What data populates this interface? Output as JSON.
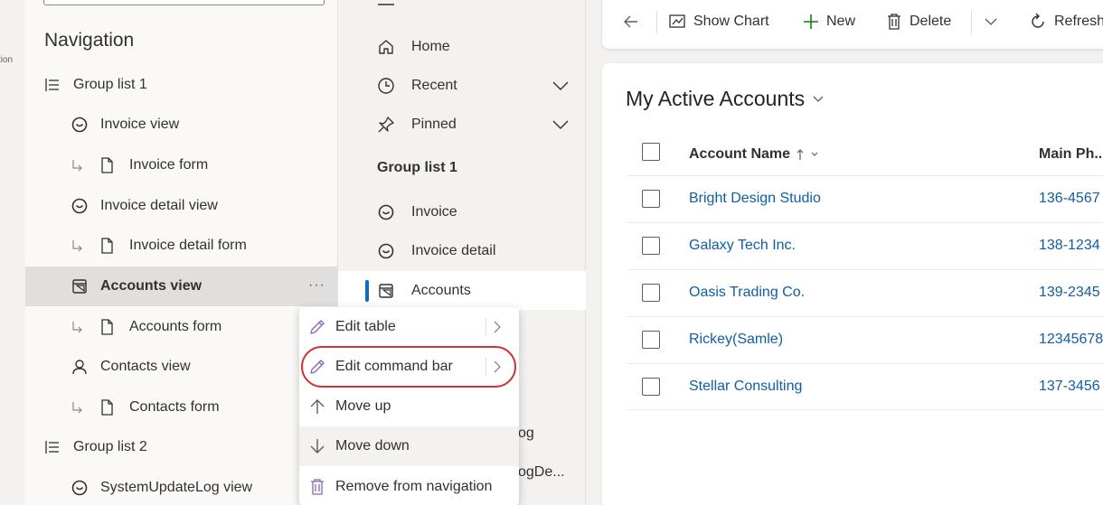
{
  "rail": {
    "label": "tion"
  },
  "navigation": {
    "title": "Navigation",
    "items": [
      {
        "label": "Group list 1",
        "icon": "list-icon",
        "level": "group"
      },
      {
        "label": "Invoice view",
        "icon": "view-icon",
        "level": "page"
      },
      {
        "label": "Invoice form",
        "icon": "document-icon",
        "level": "subpage"
      },
      {
        "label": "Invoice detail view",
        "icon": "view-icon",
        "level": "page"
      },
      {
        "label": "Invoice detail form",
        "icon": "document-icon",
        "level": "subpage"
      },
      {
        "label": "Accounts view",
        "icon": "table-icon",
        "level": "page",
        "selected": true,
        "more": "···"
      },
      {
        "label": "Accounts form",
        "icon": "document-icon",
        "level": "subpage"
      },
      {
        "label": "Contacts view",
        "icon": "person-icon",
        "level": "page"
      },
      {
        "label": "Contacts form",
        "icon": "document-icon",
        "level": "subpage"
      },
      {
        "label": "Group list 2",
        "icon": "list-icon",
        "level": "group"
      },
      {
        "label": "SystemUpdateLog view",
        "icon": "view-icon",
        "level": "page"
      }
    ]
  },
  "preview": {
    "items": [
      {
        "label": "Home",
        "icon": "home-icon"
      },
      {
        "label": "Recent",
        "icon": "clock-icon",
        "expandable": true
      },
      {
        "label": "Pinned",
        "icon": "pin-icon",
        "expandable": true
      }
    ],
    "group_label": "Group list 1",
    "group_items": [
      {
        "label": "Invoice",
        "icon": "view-icon"
      },
      {
        "label": "Invoice detail",
        "icon": "view-icon"
      },
      {
        "label": "Accounts",
        "icon": "table-icon",
        "active": true
      }
    ],
    "truncated": [
      "og",
      "ogDe..."
    ]
  },
  "commandbar": {
    "show_chart": "Show Chart",
    "new": "New",
    "delete": "Delete",
    "refresh": "Refresh"
  },
  "grid": {
    "view_title": "My Active Accounts",
    "columns": {
      "name": "Account Name",
      "phone": "Main Ph..."
    },
    "rows": [
      {
        "name": "Bright Design Studio",
        "phone": "136-4567"
      },
      {
        "name": "Galaxy Tech Inc.",
        "phone": "138-1234"
      },
      {
        "name": "Oasis Trading Co.",
        "phone": "139-2345"
      },
      {
        "name": "Rickey(Samle)",
        "phone": "12345678"
      },
      {
        "name": "Stellar Consulting",
        "phone": "137-3456"
      }
    ]
  },
  "context_menu": {
    "items": [
      {
        "label": "Edit table",
        "icon": "pencil-icon",
        "submenu": true
      },
      {
        "label": "Edit command bar",
        "icon": "pencil-icon",
        "submenu": true,
        "highlighted": true
      },
      {
        "label": "Move up",
        "icon": "arrow-up-icon"
      },
      {
        "label": "Move down",
        "icon": "arrow-down-icon",
        "hover": true
      },
      {
        "label": "Remove from navigation",
        "icon": "trash-icon"
      }
    ]
  },
  "colors": {
    "link": "#115ea3",
    "accent": "#0f6cbd",
    "highlight_ring": "#d13438",
    "selected_row": "#e1dfdd"
  }
}
